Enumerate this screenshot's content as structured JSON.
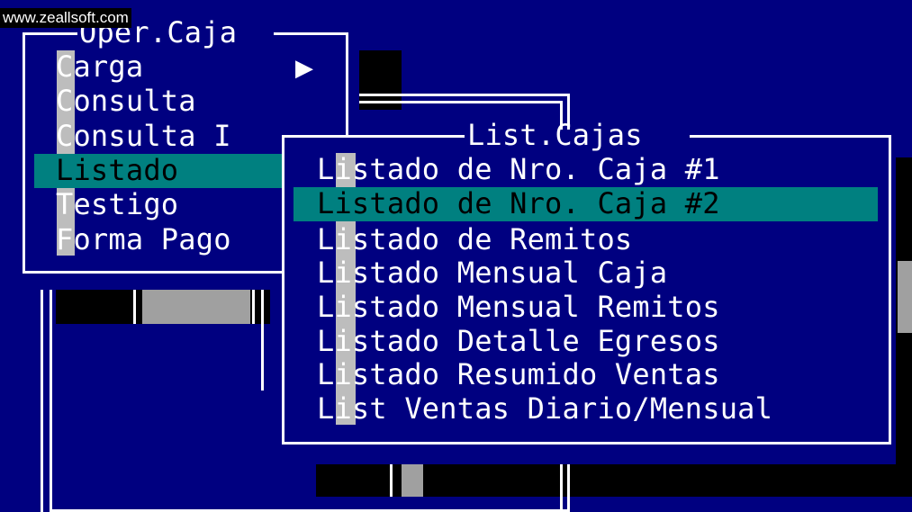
{
  "watermark": "www.zeallsoft.com",
  "oper_menu": {
    "title": "Oper.Caja",
    "items": [
      {
        "label": "Carga",
        "submenu_arrow": "▶"
      },
      {
        "label": "Consulta"
      },
      {
        "label": "Consulta I"
      },
      {
        "label": "Listado",
        "selected": true
      },
      {
        "label": "Testigo"
      },
      {
        "label": "Forma Pago"
      }
    ]
  },
  "list_cajas_menu": {
    "title": "List.Cajas",
    "items": [
      {
        "label": "Listado de Nro. Caja #1"
      },
      {
        "label": "Listado de Nro. Caja #2",
        "selected": true
      },
      {
        "label": "Listado de Remitos"
      },
      {
        "label": "Listado Mensual Caja"
      },
      {
        "label": "Listado Mensual Remitos"
      },
      {
        "label": "Listado Detalle Egresos"
      },
      {
        "label": "Listado Resumido Ventas"
      },
      {
        "label": "List Ventas Diario/Mensual"
      }
    ]
  },
  "colors": {
    "background": "#000080",
    "highlight": "#008080",
    "hotkey": "#bdbdbd",
    "text": "#ffffff"
  }
}
